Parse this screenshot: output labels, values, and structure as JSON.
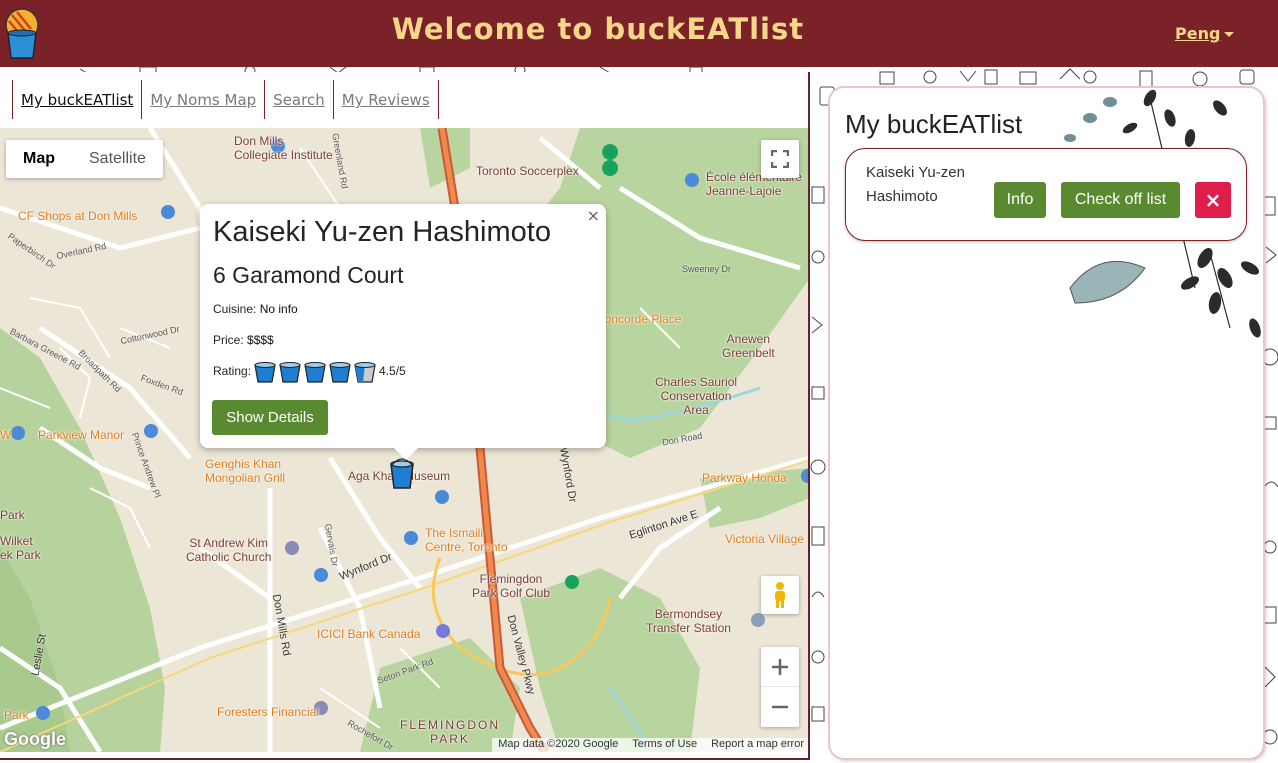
{
  "header": {
    "title": "Welcome to buckEATlist",
    "user": "Peng"
  },
  "tabs": [
    {
      "label": "My buckEATlist",
      "active": true
    },
    {
      "label": "My Noms Map",
      "active": false
    },
    {
      "label": "Search",
      "active": false
    },
    {
      "label": "My Reviews",
      "active": false
    }
  ],
  "map": {
    "type_buttons": [
      "Map",
      "Satellite"
    ],
    "selected_type": "Map",
    "attribution": [
      "Map data ©2020 Google",
      "Terms of Use",
      "Report a map error"
    ],
    "logo_text": "Google",
    "labels": {
      "don_mills_ci": "Don Mills\nCollegiate Institute",
      "toronto_soccerplex": "Toronto Soccerplex",
      "ecole": "École élémentaire\nJeanne-Lajoie",
      "cf_shops": "CF Shops at Don Mills",
      "concorde": "Concorde Place",
      "anewen": "Anewen\nGreenbelt",
      "charles": "Charles Sauriol\nConservation\nArea",
      "parkview": "Parkview Manor",
      "genghis": "Genghis Khan\nMongolian Grill",
      "aga": "Aga Khan Museum",
      "parkway_honda": "Parkway Honda",
      "ismaili": "The Ismaili\nCentre, Toronto",
      "victoria": "Victoria Village",
      "st_andrew": "St Andrew Kim\nCatholic Church",
      "flemingdon_golf": "Flemingdon\nPark Golf Club",
      "bermondsey": "Bermondsey\nTransfer Station",
      "icici": "ICICI Bank Canada",
      "foresters": "Foresters Financial",
      "flemingdon_park": "FLEMINGDON\nPARK",
      "wilket": "Wilket\nek Park",
      "park_left": "Park",
      "w_left": "W",
      "park_bottom": "Park",
      "eglinton": "Eglinton Ave E",
      "wynford": "Wynford Dr",
      "wynford2": "Wynford Dr",
      "don_mills_rd": "Don Mills Rd",
      "don_valley": "Don Valley Pkwy",
      "leslie": "Leslie St",
      "barbara": "Barbara Greene Rd",
      "overland": "Overland Rd",
      "cottonwood": "Cottonwood Dr",
      "broadpath": "Broadpath Rd",
      "foxden": "Foxden Rd",
      "sweeney": "Sweeney Dr",
      "prince_andrew": "Prince Andrew Pl",
      "gervais": "Gervais Dr",
      "seton_park": "Seton Park Rd",
      "rochefort": "Rochefort Dr",
      "greenland": "Greenland Rd",
      "papertown": "Paperbirch Dr",
      "don_road": "Don Road"
    }
  },
  "popup": {
    "name": "Kaiseki Yu-zen Hashimoto",
    "address": "6 Garamond Court",
    "cuisine_label": "Cuisine:",
    "cuisine_value": "No info",
    "price_label": "Price:",
    "price_value": "$$$$",
    "rating_label": "Rating:",
    "rating_value": 4.5,
    "rating_text": "4.5/5",
    "button": "Show Details",
    "close": "×"
  },
  "buckeatlist": {
    "title": "My buckEATlist",
    "items": [
      {
        "name": "Kaiseki Yu-zen Hashimoto",
        "info_label": "Info",
        "check_label": "Check off list",
        "delete_label": "×"
      }
    ]
  },
  "colors": {
    "header_bg": "#7b2229",
    "header_text": "#f6d78a",
    "button_green": "#5a8a30",
    "button_red": "#e01e4b"
  }
}
